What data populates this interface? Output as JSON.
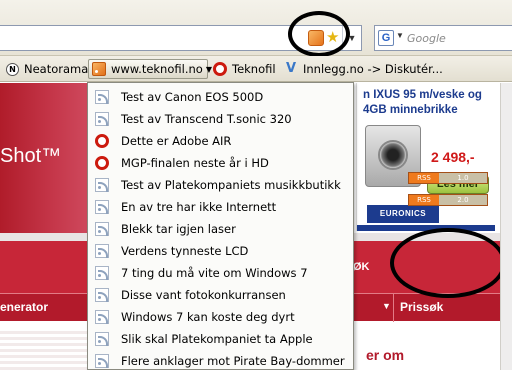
{
  "toolbar": {
    "search_placeholder": "Google",
    "search_engine_letter": "G"
  },
  "bookmarks": {
    "items": [
      {
        "label": "Neatorama",
        "icon": "neatorama-icon"
      },
      {
        "label": "www.teknofil.no",
        "icon": "rss-feed-icon"
      },
      {
        "label": "Teknofil",
        "icon": "opera-icon"
      },
      {
        "label": "Innlegg.no -> Diskutér...",
        "icon": "v-icon"
      }
    ],
    "neatorama_glyph": "N",
    "v_glyph": "V"
  },
  "feed_menu": {
    "items": [
      {
        "label": "Test av Canon EOS 500D",
        "icon": "feed-item-icon"
      },
      {
        "label": "Test av Transcend T.sonic 320",
        "icon": "feed-item-icon"
      },
      {
        "label": "Dette er Adobe AIR",
        "icon": "opera-icon"
      },
      {
        "label": "MGP-finalen neste år i HD",
        "icon": "opera-icon"
      },
      {
        "label": "Test av Platekompaniets musikkbutikk",
        "icon": "feed-item-icon"
      },
      {
        "label": "En av tre har ikke Internett",
        "icon": "feed-item-icon"
      },
      {
        "label": "Blekk tar igjen laser",
        "icon": "feed-item-icon"
      },
      {
        "label": "Verdens tynneste LCD",
        "icon": "feed-item-icon"
      },
      {
        "label": "7 ting du må vite om Windows 7",
        "icon": "feed-item-icon"
      },
      {
        "label": "Disse vant fotokonkurransen",
        "icon": "feed-item-icon"
      },
      {
        "label": "Windows 7 kan koste deg dyrt",
        "icon": "feed-item-icon"
      },
      {
        "label": "Slik skal Platekompaniet ta Apple",
        "icon": "feed-item-icon"
      },
      {
        "label": "Flere anklager mot Pirate Bay-dommer",
        "icon": "feed-item-icon"
      }
    ]
  },
  "page": {
    "hero_title": "Shot™",
    "band_text": "ØK",
    "nav_left": "enerator",
    "nav_right": "Prissøk",
    "section_heading": "er om",
    "ad": {
      "line1": "n IXUS 95 m/veske og",
      "line2": "4GB minnebrikke",
      "price": "2 498,-",
      "cta": "Les mer",
      "brand": "EURONICS"
    },
    "rss_badges": [
      {
        "left": "RSS",
        "right": "1.0"
      },
      {
        "left": "RSS",
        "right": "2.0"
      }
    ]
  },
  "colors": {
    "brand_red": "#c72638",
    "annotation": "#000000",
    "feed_orange": "#ef7a1d"
  }
}
